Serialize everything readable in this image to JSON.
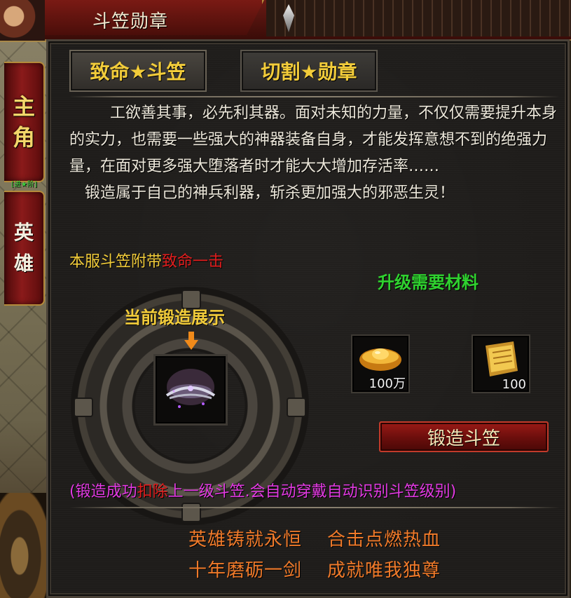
{
  "window": {
    "title": "斗笠勋章"
  },
  "side_tabs": {
    "main": [
      "主",
      "角"
    ],
    "main_sub_label": "[进★阶]",
    "hero": [
      "英",
      "雄"
    ]
  },
  "tabs": [
    {
      "label": "致命★斗笠",
      "active": true
    },
    {
      "label": "切割★勋章",
      "active": false
    }
  ],
  "description": {
    "para1": "工欲善其事，必先利其器。面对未知的力量，不仅仅需要提升本身的实力，也需要一些强大的神器装备自身，才能发挥意想不到的绝强力量，在面对更多强大堕落者时才能大大增加存活率……",
    "para2": "锻造属于自己的神兵利器，斩杀更加强大的邪恶生灵！"
  },
  "note": {
    "prefix": "本服斗笠附带",
    "highlight": "致命一击"
  },
  "forge": {
    "display_label": "当前锻造展示",
    "item_icon": "hat-icon"
  },
  "materials": {
    "title": "升级需要材料",
    "items": [
      {
        "icon": "gold-ingot-icon",
        "count": "100万"
      },
      {
        "icon": "scroll-icon",
        "count": "100"
      }
    ]
  },
  "actions": {
    "forge_button": "锻造斗笠"
  },
  "hint": {
    "part1": "(锻造成功",
    "highlight": "扣除",
    "part2": "上一级斗笠.会自动穿戴自动识别斗笠级别)"
  },
  "slogans": [
    [
      "英雄铸就永恒",
      "合击点燃热血"
    ],
    [
      "十年磨砺一剑",
      "成就唯我独尊"
    ]
  ],
  "colors": {
    "accent_yellow": "#f2cc3a",
    "highlight_red": "#e21e1e",
    "material_green": "#2fd22f",
    "hint_magenta": "#e23ae2",
    "slogan_orange": "#f07a2a"
  }
}
